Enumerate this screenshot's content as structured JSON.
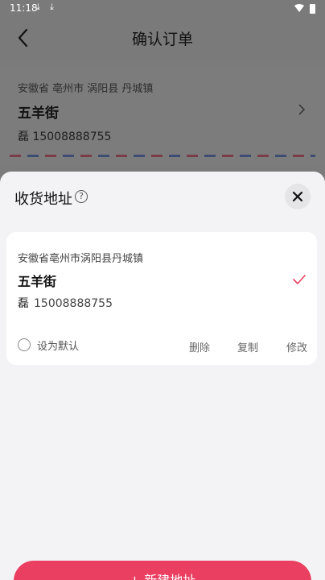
{
  "status_bar": {
    "time": "11:18",
    "icons": [
      "download-icon",
      "download-icon",
      "wifi-icon",
      "battery-icon"
    ]
  },
  "nav": {
    "title": "确认订单",
    "back_icon": "back-arrow-icon"
  },
  "order_address": {
    "region": "安徽省 亳州市 涡阳县 丹城镇",
    "street": "五羊街",
    "contact": "磊 15008888755"
  },
  "sheet": {
    "title": "收货地址",
    "help_icon": "?",
    "addresses": [
      {
        "region": "安徽省亳州市涡阳县丹城镇",
        "street": "五羊街",
        "name": "磊",
        "phone": "15008888755",
        "selected": true,
        "default_label": "设为默认",
        "actions": {
          "delete": "删除",
          "copy": "复制",
          "edit": "修改"
        }
      }
    ],
    "new_address_label": "+ 新建地址"
  },
  "colors": {
    "accent": "#ea3f61",
    "sheet_bg": "#f3f3f5",
    "overlay": "#7b7b7b"
  }
}
